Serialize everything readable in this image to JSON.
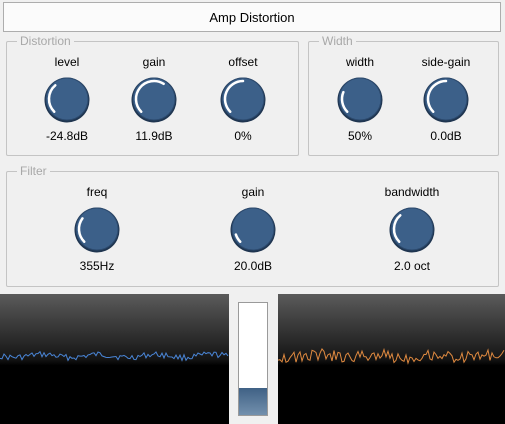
{
  "title": "Amp Distortion",
  "colors": {
    "knob_fill": "#3c6089",
    "knob_highlight": "#ffffff",
    "left_wave": "#4a86d8",
    "right_wave": "#e08a40"
  },
  "distortion": {
    "label": "Distortion",
    "knobs": [
      {
        "label": "level",
        "value": "-24.8dB",
        "amount": 0.35
      },
      {
        "label": "gain",
        "value": "11.9dB",
        "amount": 0.62
      },
      {
        "label": "offset",
        "value": "0%",
        "amount": 0.5
      }
    ]
  },
  "width": {
    "label": "Width",
    "knobs": [
      {
        "label": "width",
        "value": "50%",
        "amount": 0.25
      },
      {
        "label": "side-gain",
        "value": "0.0dB",
        "amount": 0.5
      }
    ]
  },
  "filter": {
    "label": "Filter",
    "knobs": [
      {
        "label": "freq",
        "value": "355Hz",
        "amount": 0.3
      },
      {
        "label": "gain",
        "value": "20.0dB",
        "amount": 0.1
      },
      {
        "label": "bandwidth",
        "value": "2.0 oct",
        "amount": 0.35
      }
    ]
  },
  "meter": {
    "level": 0.24
  }
}
